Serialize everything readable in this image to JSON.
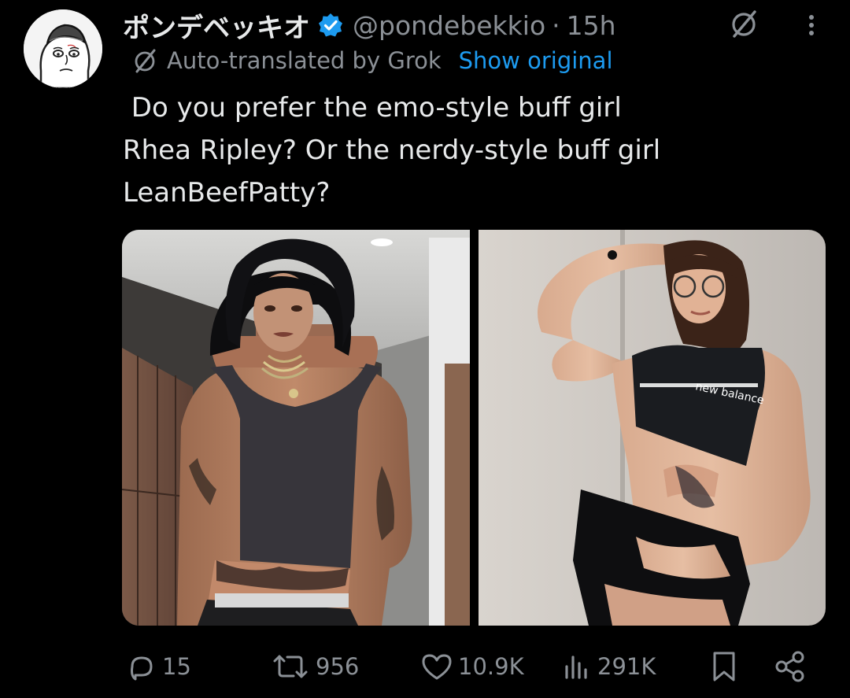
{
  "tweet": {
    "display_name": "ポンデベッキオ",
    "handle": "@pondebekkio",
    "separator": "·",
    "time": "15h",
    "translation_note": "Auto-translated by Grok",
    "show_original": "Show original",
    "text_lines": [
      " Do you prefer the emo-style buff girl",
      "Rhea Ripley? Or the nerdy-style buff girl",
      "LeanBeefPatty?"
    ],
    "bra_brand_text": "new balance"
  },
  "actions": {
    "replies": "15",
    "reposts": "956",
    "likes": "10.9K",
    "views": "291K"
  },
  "icons": {
    "verified": "verified-badge-icon",
    "grok": "grok-icon",
    "more": "more-options-icon",
    "reply": "reply-icon",
    "repost": "repost-icon",
    "like": "heart-icon",
    "views": "views-icon",
    "bookmark": "bookmark-icon",
    "share": "share-icon"
  },
  "colors": {
    "background": "#000000",
    "text": "#e7e9ea",
    "muted": "#8b9096",
    "link": "#1d9bf0",
    "verified": "#1d9bf0"
  }
}
